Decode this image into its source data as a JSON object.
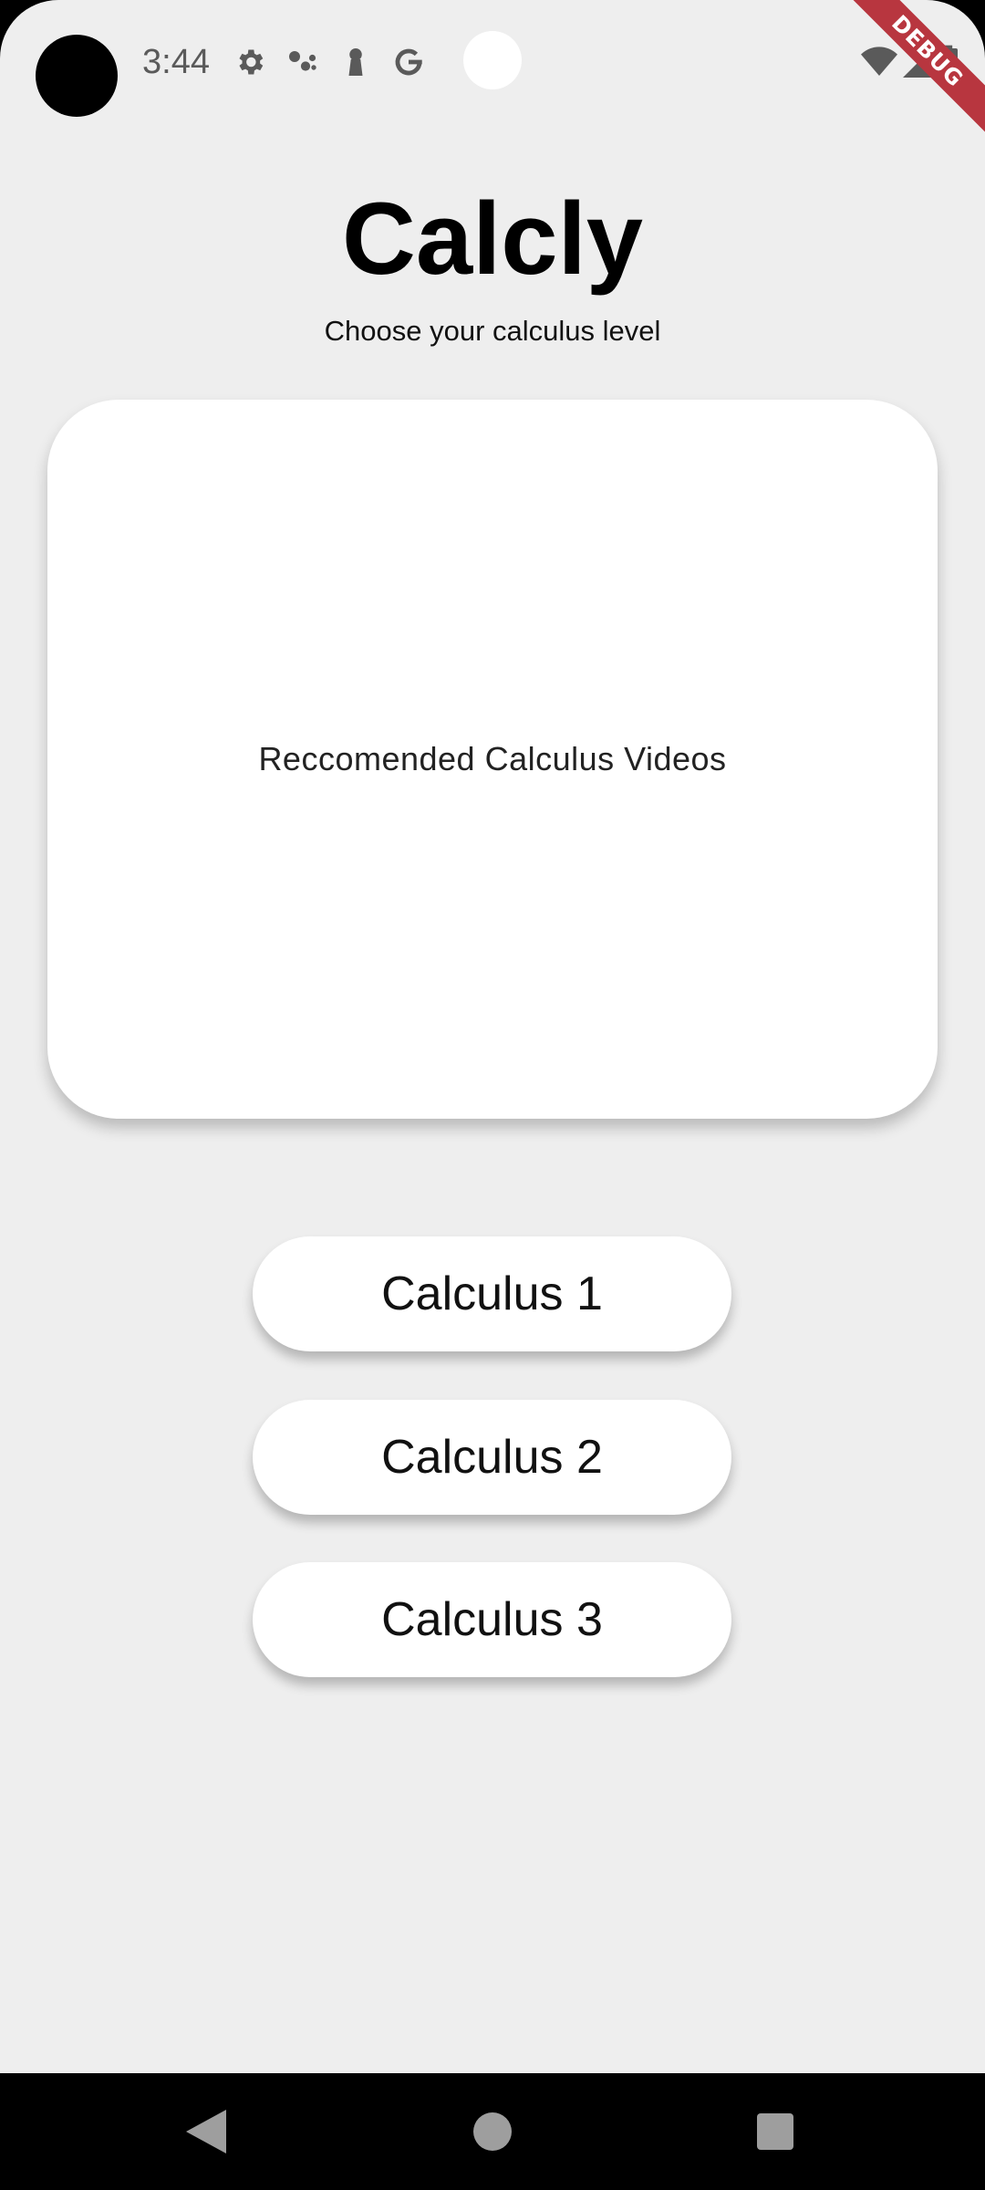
{
  "status_bar": {
    "time": "3:44",
    "left_icons": [
      "settings-icon",
      "assistant-icon",
      "keyhole-icon",
      "google-icon"
    ],
    "right_icons": [
      "wifi-icon",
      "signal-icon",
      "battery-icon"
    ],
    "debug_banner": "DEBUG"
  },
  "header": {
    "title": "Calcly",
    "subtitle": "Choose your calculus level"
  },
  "video_card": {
    "label": "Reccomended Calculus Videos"
  },
  "level_buttons": [
    {
      "label": "Calculus 1"
    },
    {
      "label": "Calculus 2"
    },
    {
      "label": "Calculus 3"
    }
  ],
  "nav_bar": {
    "icons": [
      "back-icon",
      "home-icon",
      "recents-icon"
    ]
  },
  "colors": {
    "background": "#eeeeee",
    "card": "#ffffff",
    "debug_ribbon": "#b8363f",
    "status_icon": "#5a5a5a"
  }
}
